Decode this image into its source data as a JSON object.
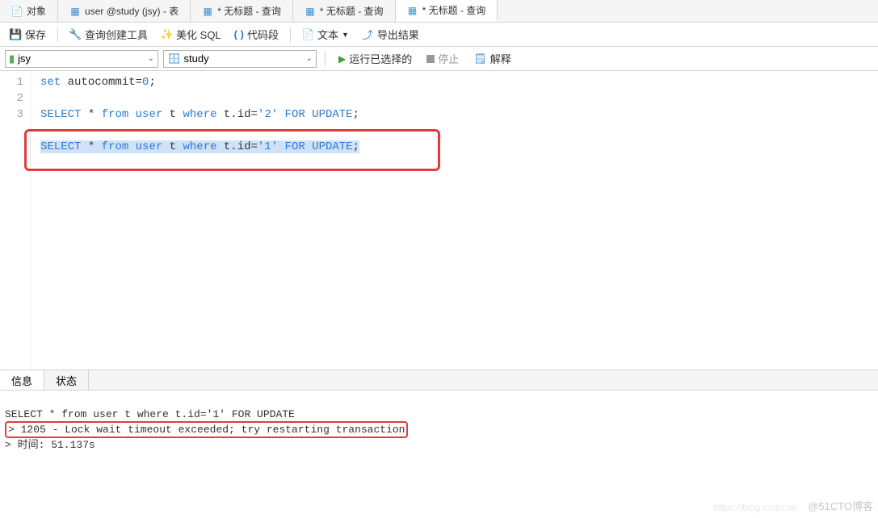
{
  "tabs": {
    "items": [
      {
        "label": "对象",
        "icon": "objects"
      },
      {
        "label": "user @study (jsy) - 表",
        "icon": "table"
      },
      {
        "label": "* 无标题 - 查询",
        "icon": "query"
      },
      {
        "label": "* 无标题 - 查询",
        "icon": "query"
      },
      {
        "label": "* 无标题 - 查询",
        "icon": "query",
        "active": true
      }
    ]
  },
  "toolbar": {
    "save": "保存",
    "query_builder": "查询创建工具",
    "beautify_sql": "美化 SQL",
    "code_snippet": "代码段",
    "text": "文本",
    "export_result": "导出结果"
  },
  "connection_row": {
    "connection": "jsy",
    "database": "study",
    "run_selected": "运行已选择的",
    "stop": "停止",
    "explain": "解释"
  },
  "editor": {
    "lines": [
      {
        "num": "1",
        "tokens": [
          {
            "t": "set",
            "c": "kw"
          },
          {
            "t": " autocommit",
            "c": "ident"
          },
          {
            "t": "=",
            "c": "punct"
          },
          {
            "t": "0",
            "c": "num"
          },
          {
            "t": ";",
            "c": "punct"
          }
        ]
      },
      {
        "num": "2",
        "tokens": []
      },
      {
        "num": "3",
        "tokens": [
          {
            "t": "SELECT",
            "c": "kw"
          },
          {
            "t": " * ",
            "c": "ident"
          },
          {
            "t": "from",
            "c": "kw"
          },
          {
            "t": " ",
            "c": "ident"
          },
          {
            "t": "user",
            "c": "kw"
          },
          {
            "t": " t ",
            "c": "ident"
          },
          {
            "t": "where",
            "c": "kw"
          },
          {
            "t": " t.id=",
            "c": "ident"
          },
          {
            "t": "'2'",
            "c": "str"
          },
          {
            "t": " ",
            "c": "ident"
          },
          {
            "t": "FOR",
            "c": "kw"
          },
          {
            "t": " ",
            "c": "ident"
          },
          {
            "t": "UPDATE",
            "c": "kw"
          },
          {
            "t": ";",
            "c": "punct"
          }
        ]
      },
      {
        "num": "",
        "tokens": []
      },
      {
        "num": "",
        "selected": true,
        "tokens": [
          {
            "t": "SELECT",
            "c": "kw"
          },
          {
            "t": " * ",
            "c": "ident"
          },
          {
            "t": "from",
            "c": "kw"
          },
          {
            "t": " ",
            "c": "ident"
          },
          {
            "t": "user",
            "c": "kw"
          },
          {
            "t": " t ",
            "c": "ident"
          },
          {
            "t": "where",
            "c": "kw"
          },
          {
            "t": " t.id=",
            "c": "ident"
          },
          {
            "t": "'1'",
            "c": "str"
          },
          {
            "t": " ",
            "c": "ident"
          },
          {
            "t": "FOR",
            "c": "kw"
          },
          {
            "t": " ",
            "c": "ident"
          },
          {
            "t": "UPDATE",
            "c": "kw"
          },
          {
            "t": ";",
            "c": "punct"
          }
        ]
      }
    ]
  },
  "bottom_tabs": {
    "info": "信息",
    "status": "状态"
  },
  "output": {
    "line1": "SELECT * from user t where t.id='1' FOR UPDATE",
    "err": "> 1205 - Lock wait timeout exceeded; try restarting transaction",
    "time": "> 时间: 51.137s"
  },
  "watermark": {
    "left": "https://blog.csdn.ne",
    "right": "@51CTO博客"
  }
}
